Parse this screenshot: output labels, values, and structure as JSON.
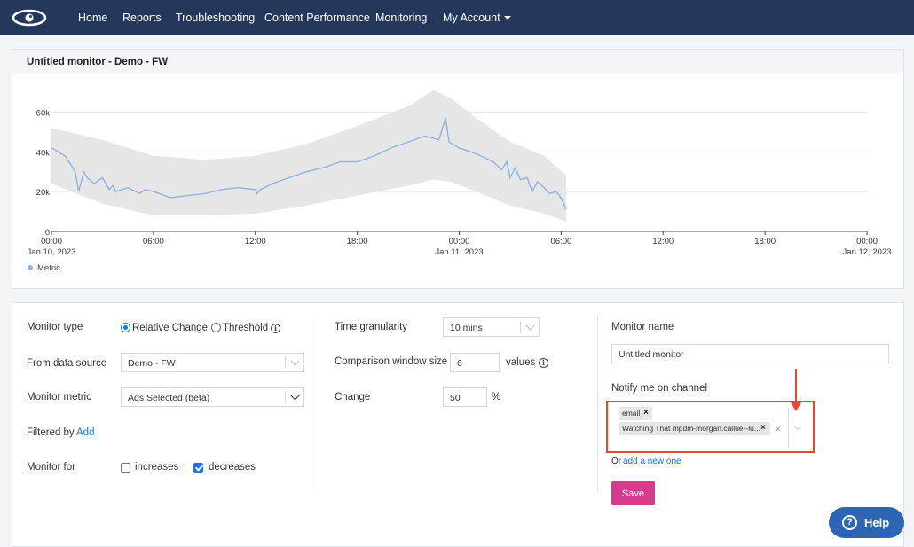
{
  "nav": {
    "items": [
      "Home",
      "Reports",
      "Troubleshooting",
      "Content Performance",
      "Monitoring",
      "My Account"
    ]
  },
  "colors": {
    "navbar": "#23385b",
    "accent": "#1a73e8",
    "save": "#d63a8c",
    "highlight": "#e64a2e",
    "band": "#e6e6e6",
    "line": "#8db4e2"
  },
  "monitor_card": {
    "title": "Untitled monitor - Demo - FW"
  },
  "chart_data": {
    "type": "line",
    "title": "",
    "legend": "Metric",
    "legend_position": "bottom-left",
    "grid": true,
    "ylim": [
      0,
      70000
    ],
    "y_ticks": [
      "0",
      "20k",
      "40k",
      "60k"
    ],
    "x_ticks": [
      {
        "time": "00:00",
        "date": "Jan 10, 2023"
      },
      {
        "time": "06:00",
        "date": ""
      },
      {
        "time": "12:00",
        "date": ""
      },
      {
        "time": "18:00",
        "date": ""
      },
      {
        "time": "00:00",
        "date": "Jan 11, 2023"
      },
      {
        "time": "06:00",
        "date": ""
      },
      {
        "time": "12:00",
        "date": ""
      },
      {
        "time": "18:00",
        "date": ""
      },
      {
        "time": "00:00",
        "date": "Jan 12, 2023"
      }
    ],
    "xlim_hours": [
      0,
      48
    ],
    "series": [
      {
        "name": "Metric",
        "x": [
          0,
          0.8,
          1.4,
          1.6,
          1.9,
          2.1,
          2.5,
          3.0,
          3.4,
          3.6,
          3.8,
          4.5,
          5.2,
          5.5,
          6.0,
          7.0,
          8.0,
          9.0,
          10.0,
          11.0,
          12.0,
          12.1,
          12.3,
          13.0,
          14.0,
          15.0,
          16.0,
          17.0,
          18.0,
          19.0,
          20.0,
          21.0,
          22.0,
          22.8,
          23.2,
          23.4,
          24.0,
          25.0,
          26.0,
          26.5,
          26.8,
          27.0,
          27.3,
          27.6,
          28.0,
          28.3,
          28.6,
          29.0,
          29.3,
          29.7,
          29.9,
          30.1,
          30.3
        ],
        "values": [
          42000,
          38000,
          30000,
          20000,
          30000,
          27000,
          24000,
          27000,
          21000,
          23000,
          20000,
          22000,
          19000,
          21000,
          20000,
          17000,
          18000,
          19000,
          21000,
          22000,
          21000,
          19000,
          21000,
          24000,
          27000,
          30000,
          32000,
          35000,
          35000,
          38000,
          42000,
          45000,
          48000,
          46000,
          57000,
          45000,
          42000,
          39000,
          35000,
          31000,
          35000,
          27000,
          32000,
          26000,
          27000,
          20000,
          25000,
          22000,
          19000,
          20000,
          18000,
          15000,
          11000
        ]
      },
      {
        "name": "band_upper",
        "x": [
          0,
          3,
          6,
          9,
          12,
          15,
          18,
          21,
          22.5,
          23.5,
          25,
          27,
          29,
          30.3
        ],
        "values": [
          52000,
          46000,
          38000,
          36000,
          38000,
          44000,
          53000,
          63000,
          71000,
          67000,
          57000,
          45000,
          38000,
          28000
        ]
      },
      {
        "name": "band_lower",
        "x": [
          0,
          3,
          6,
          9,
          12,
          15,
          18,
          21,
          22.5,
          23.5,
          25,
          27,
          29,
          30.3
        ],
        "values": [
          24000,
          14000,
          8000,
          8000,
          9000,
          13000,
          18000,
          23000,
          26000,
          25000,
          20000,
          13000,
          9000,
          5000
        ]
      }
    ]
  },
  "form": {
    "monitor_type_label": "Monitor type",
    "relative_change": "Relative Change",
    "threshold": "Threshold",
    "from_source_label": "From data source",
    "from_source_value": "Demo - FW",
    "metric_label": "Monitor metric",
    "metric_value": "Ads Selected (beta)",
    "filtered_by_label": "Filtered by",
    "add_link": "Add",
    "monitor_for_label": "Monitor for",
    "increases": "increases",
    "decreases": "decreases",
    "time_gran_label": "Time granularity",
    "time_gran_value": "10 mins",
    "comparison_label": "Comparison window size",
    "comparison_value": "6",
    "comparison_unit": "values",
    "change_label": "Change",
    "change_value": "50",
    "change_unit": "%",
    "monitor_name_label": "Monitor name",
    "monitor_name_value": "Untitled monitor",
    "notify_label": "Notify me on channel",
    "tags": [
      "email",
      "Watching That mpdm-morgan.callue--lu..."
    ],
    "or_text": "Or",
    "add_new_link": "add a new one",
    "save_label": "Save"
  },
  "help": {
    "label": "Help"
  }
}
